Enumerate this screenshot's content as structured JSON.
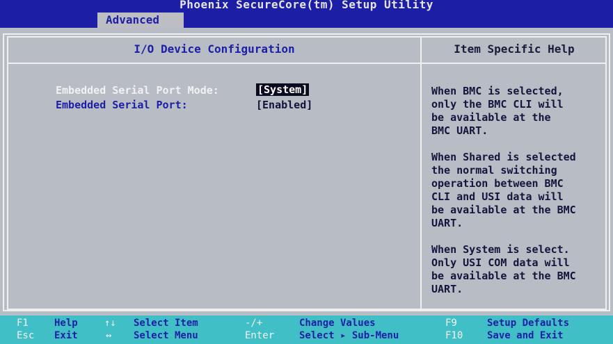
{
  "app_title": "Phoenix SecureCore(tm) Setup Utility",
  "active_tab": "Advanced",
  "section_title": "I/O Device Configuration",
  "help_title": "Item Specific Help",
  "settings": [
    {
      "label": "Embedded Serial Port Mode:",
      "value": "[System]",
      "selected": true
    },
    {
      "label": "Embedded Serial Port:",
      "value": "[Enabled]",
      "selected": false
    }
  ],
  "help_paragraphs": [
    "When BMC is selected,\nonly the BMC CLI will\nbe available at the\nBMC UART.",
    "When Shared is selected\nthe normal switching\noperation between BMC\nCLI and USI data will\nbe available at the BMC\nUART.",
    "When System is select.\nOnly USI COM data will\nbe available at the BMC\nUART."
  ],
  "footer": {
    "f1_key": "F1",
    "f1_label": "Help",
    "updown_key": "↑↓",
    "updown_label": "Select Item",
    "minusplus_key": "-/+",
    "minusplus_label": "Change Values",
    "f9_key": "F9",
    "f9_label": "Setup Defaults",
    "esc_key": "Esc",
    "esc_label": "Exit",
    "leftright_key": "↔",
    "leftright_label": "Select Menu",
    "enter_key": "Enter",
    "enter_label": "Select ▸ Sub-Menu",
    "f10_key": "F10",
    "f10_label": "Save and Exit"
  },
  "colors": {
    "header_blue": "#1c1fa6",
    "panel_gray": "#b8bcc4",
    "footer_cyan": "#41bfc6"
  }
}
